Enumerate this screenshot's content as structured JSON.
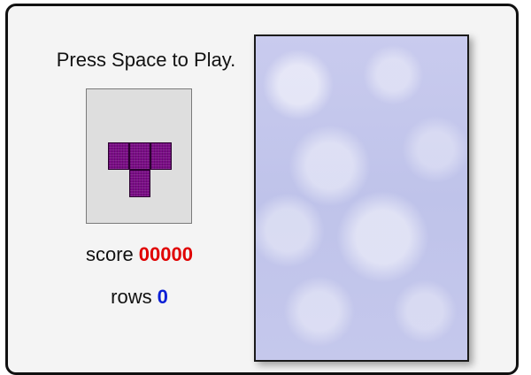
{
  "game": {
    "prompt": "Press Space to Play.",
    "next_piece": {
      "name": "T-piece",
      "color": "#7a0c86",
      "cells": [
        [
          0,
          0
        ],
        [
          1,
          0
        ],
        [
          2,
          0
        ],
        [
          1,
          1
        ]
      ]
    },
    "score": {
      "label": "score",
      "value": "00000",
      "color": "#e00000"
    },
    "rows": {
      "label": "rows",
      "value": "0",
      "color": "#0a1fd6"
    },
    "board": {
      "background": "#c5c8ec",
      "state": "empty"
    }
  }
}
